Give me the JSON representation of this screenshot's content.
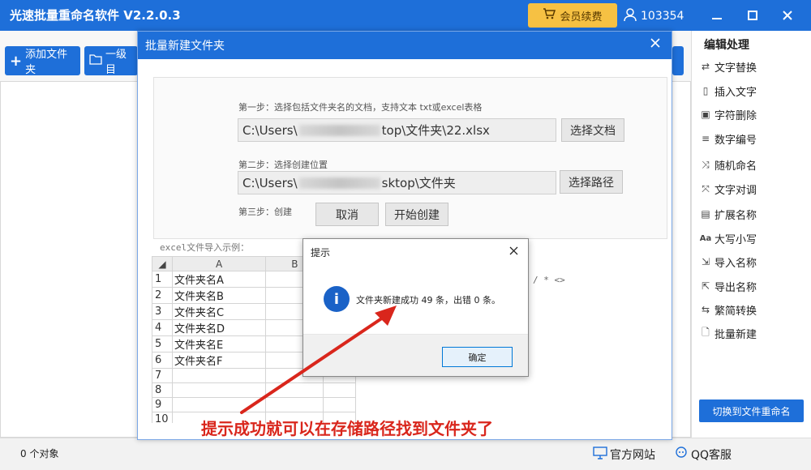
{
  "app": {
    "title": "光速批量重命名软件 V2.2.0.3",
    "vip_label": "会员续费",
    "user_id": "103354"
  },
  "toolbar": {
    "add_folder": "添加文件夹",
    "level_one": "一级目"
  },
  "right_panel": {
    "title": "编辑处理",
    "items": [
      {
        "label": "文字替换",
        "icon": "replace-icon"
      },
      {
        "label": "插入文字",
        "icon": "insert-text-icon"
      },
      {
        "label": "字符删除",
        "icon": "delete-char-icon"
      },
      {
        "label": "数字编号",
        "icon": "numbering-icon"
      },
      {
        "label": "随机命名",
        "icon": "shuffle-icon"
      },
      {
        "label": "文字对调",
        "icon": "swap-icon"
      },
      {
        "label": "扩展名称",
        "icon": "extension-icon"
      },
      {
        "label": "大写小写",
        "icon": "case-icon"
      },
      {
        "label": "导入名称",
        "icon": "import-icon"
      },
      {
        "label": "导出名称",
        "icon": "export-icon"
      },
      {
        "label": "繁简转换",
        "icon": "convert-icon"
      },
      {
        "label": "批量新建",
        "icon": "new-file-icon"
      }
    ],
    "switch_label": "切换到文件重命名"
  },
  "statusbar": {
    "object_count": "0 个对象",
    "official_site": "官方网站",
    "qq_service": "QQ客服"
  },
  "dialog": {
    "title": "批量新建文件夹",
    "step1_label": "第一步：选择包括文件夹名的文档，支持文本 txt或excel表格",
    "file_path_start": "C:\\Users\\",
    "file_path_end": "top\\文件夹\\22.xlsx",
    "choose_doc": "选择文档",
    "step2_label": "第二步：选择创建位置",
    "dir_path_start": "C:\\Users\\",
    "dir_path_end": "sktop\\文件夹",
    "choose_path": "选择路径",
    "step3_label": "第三步：创建",
    "cancel": "取消",
    "start_create": "开始创建",
    "example_label": "excel文件导入示例：",
    "col_a": "A",
    "col_b": "B",
    "rows": [
      "文件夹名A",
      "文件夹名B",
      "文件夹名C",
      "文件夹名D",
      "文件夹名E",
      "文件夹名F",
      "",
      "",
      "",
      "",
      ""
    ],
    "forbidden_chars": "/ * <>"
  },
  "msgbox": {
    "title": "提示",
    "message": "文件夹新建成功 49 条，出错 0 条。",
    "ok": "确定"
  },
  "annotation": "提示成功就可以在存储路径找到文件夹了",
  "colors": {
    "primary": "#1e6fd9",
    "vip": "#f6c143",
    "annotation": "#d9261c"
  }
}
